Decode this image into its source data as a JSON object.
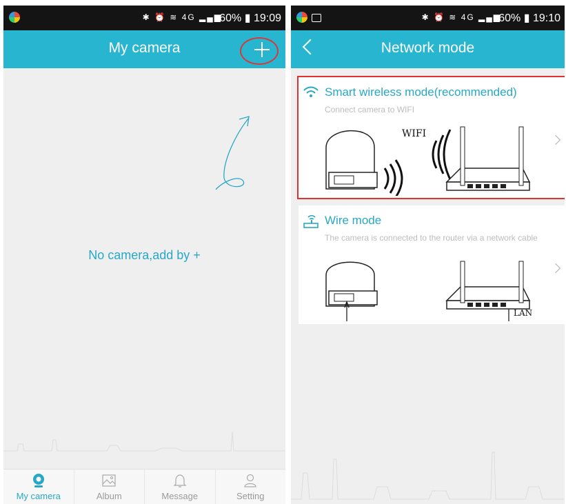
{
  "left": {
    "status": {
      "icons": "✱ ⏰ ≋ 4G ▂▄▆",
      "battery": "60%",
      "time": "19:09"
    },
    "appbar": {
      "title": "My camera"
    },
    "empty_message": "No camera,add by +",
    "tabs": [
      {
        "label": "My camera",
        "icon": "camera-icon",
        "active": true
      },
      {
        "label": "Album",
        "icon": "image-icon",
        "active": false
      },
      {
        "label": "Message",
        "icon": "bell-icon",
        "active": false
      },
      {
        "label": "Setting",
        "icon": "person-icon",
        "active": false
      }
    ]
  },
  "right": {
    "status": {
      "icons": "✱ ⏰ ≋ 4G ▂▄▆",
      "battery": "60%",
      "time": "19:10"
    },
    "appbar": {
      "title": "Network mode"
    },
    "options": [
      {
        "title": "Smart wireless mode(recommended)",
        "description": "Connect camera to WIFI",
        "illustration_label": "WIFI"
      },
      {
        "title": "Wire mode",
        "description": "The camera is connected to the router via a network cable",
        "illustration_label": "LAN"
      }
    ]
  },
  "colors": {
    "accent": "#27b5d0",
    "highlight": "#e2302e",
    "text_accent": "#27a8c6"
  }
}
